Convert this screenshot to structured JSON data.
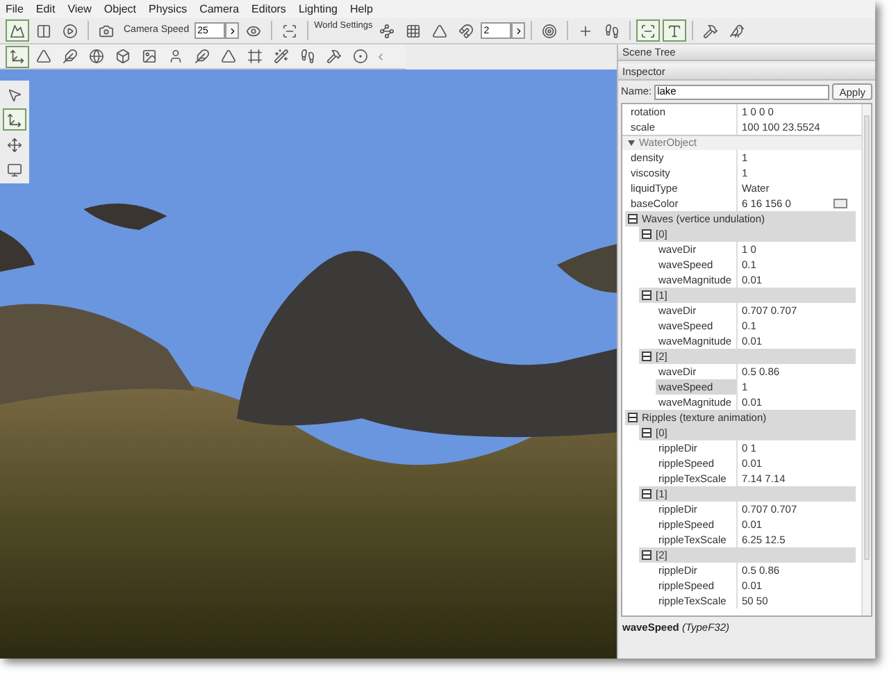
{
  "menu": [
    "File",
    "Edit",
    "View",
    "Object",
    "Physics",
    "Camera",
    "Editors",
    "Lighting",
    "Help"
  ],
  "toolbar": {
    "camera_speed_label": "Camera Speed",
    "camera_speed_value": "25",
    "world_settings": "World Settings",
    "snap_value": "2"
  },
  "panel": {
    "scene_tree_title": "Scene Tree",
    "inspector_title": "Inspector",
    "name_label": "Name:",
    "name_value": "lake",
    "apply": "Apply"
  },
  "properties": [
    {
      "kind": "row",
      "label": "rotation",
      "value": "1 0 0 0",
      "selected": false
    },
    {
      "kind": "row",
      "label": "scale",
      "value": "100 100 23.5524",
      "selected": false
    },
    {
      "kind": "section",
      "label": "WaterObject",
      "expanded": true,
      "children": [
        {
          "kind": "row",
          "label": "density",
          "value": "1",
          "selected": false
        },
        {
          "kind": "row",
          "label": "viscosity",
          "value": "1",
          "selected": false
        },
        {
          "kind": "row",
          "label": "liquidType",
          "value": "Water",
          "selected": false
        },
        {
          "kind": "color",
          "label": "baseColor",
          "value": "6 16 156 0",
          "selected": false
        },
        {
          "kind": "group",
          "label": "Waves (vertice undulation)",
          "expanded": true,
          "children": [
            {
              "kind": "group",
              "label": "[0]",
              "expanded": true,
              "children": [
                {
                  "kind": "row",
                  "label": "waveDir",
                  "value": "1 0",
                  "selected": false
                },
                {
                  "kind": "row",
                  "label": "waveSpeed",
                  "value": "0.1",
                  "selected": false
                },
                {
                  "kind": "row",
                  "label": "waveMagnitude",
                  "value": "0.01",
                  "selected": false
                }
              ]
            },
            {
              "kind": "group",
              "label": "[1]",
              "expanded": true,
              "children": [
                {
                  "kind": "row",
                  "label": "waveDir",
                  "value": "0.707 0.707",
                  "selected": false
                },
                {
                  "kind": "row",
                  "label": "waveSpeed",
                  "value": "0.1",
                  "selected": false
                },
                {
                  "kind": "row",
                  "label": "waveMagnitude",
                  "value": "0.01",
                  "selected": false
                }
              ]
            },
            {
              "kind": "group",
              "label": "[2]",
              "expanded": true,
              "children": [
                {
                  "kind": "row",
                  "label": "waveDir",
                  "value": "0.5 0.86",
                  "selected": false
                },
                {
                  "kind": "row",
                  "label": "waveSpeed",
                  "value": "1",
                  "selected": true
                },
                {
                  "kind": "row",
                  "label": "waveMagnitude",
                  "value": "0.01",
                  "selected": false
                }
              ]
            }
          ]
        },
        {
          "kind": "group",
          "label": "Ripples (texture animation)",
          "expanded": true,
          "children": [
            {
              "kind": "group",
              "label": "[0]",
              "expanded": true,
              "children": [
                {
                  "kind": "row",
                  "label": "rippleDir",
                  "value": "0 1",
                  "selected": false
                },
                {
                  "kind": "row",
                  "label": "rippleSpeed",
                  "value": "0.01",
                  "selected": false
                },
                {
                  "kind": "row",
                  "label": "rippleTexScale",
                  "value": "7.14 7.14",
                  "selected": false
                }
              ]
            },
            {
              "kind": "group",
              "label": "[1]",
              "expanded": true,
              "children": [
                {
                  "kind": "row",
                  "label": "rippleDir",
                  "value": "0.707 0.707",
                  "selected": false
                },
                {
                  "kind": "row",
                  "label": "rippleSpeed",
                  "value": "0.01",
                  "selected": false
                },
                {
                  "kind": "row",
                  "label": "rippleTexScale",
                  "value": "6.25 12.5",
                  "selected": false
                }
              ]
            },
            {
              "kind": "group",
              "label": "[2]",
              "expanded": true,
              "children": [
                {
                  "kind": "row",
                  "label": "rippleDir",
                  "value": "0.5 0.86",
                  "selected": false
                },
                {
                  "kind": "row",
                  "label": "rippleSpeed",
                  "value": "0.01",
                  "selected": false
                },
                {
                  "kind": "row",
                  "label": "rippleTexScale",
                  "value": "50 50",
                  "selected": false
                }
              ]
            }
          ]
        }
      ]
    }
  ],
  "status": "**waveSpeed** *(TypeF32)*"
}
